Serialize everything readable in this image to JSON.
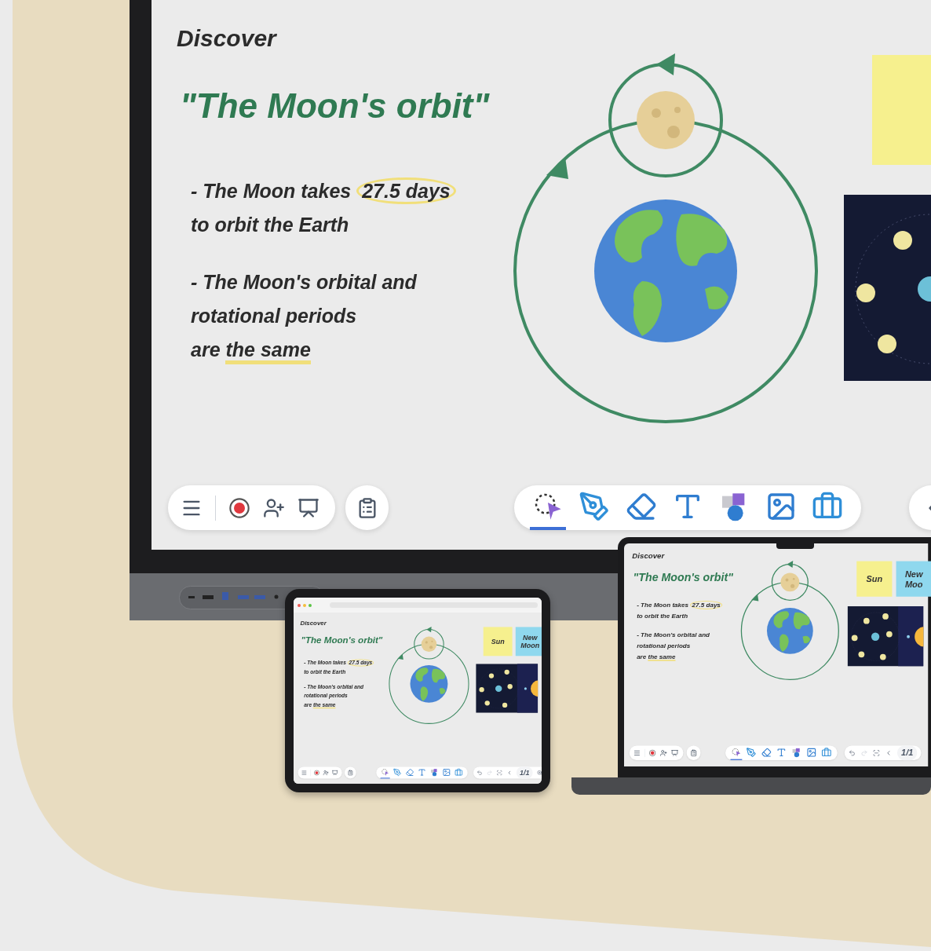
{
  "display": {
    "board": {
      "heading": "Discover",
      "title": "\"The Moon's orbit\"",
      "bullets": [
        {
          "lines": [
            [
              {
                "text": "- The Moon takes ",
                "kind": "plain"
              },
              {
                "text": "27.5 days",
                "kind": "circled"
              }
            ],
            [
              {
                "text": "to orbit the Earth",
                "kind": "plain"
              }
            ]
          ]
        },
        {
          "lines": [
            [
              {
                "text": "- The Moon's orbital and",
                "kind": "plain"
              }
            ],
            [
              {
                "text": "rotational periods",
                "kind": "plain"
              }
            ],
            [
              {
                "text": "are ",
                "kind": "plain"
              },
              {
                "text": "the same",
                "kind": "underlined"
              }
            ]
          ]
        }
      ],
      "notes": [
        {
          "color": "#f6f08e"
        }
      ],
      "tools": [
        {
          "selected": true
        },
        {
          "selected": false
        },
        {
          "selected": false
        },
        {
          "selected": false
        },
        {
          "selected": false
        },
        {
          "selected": false
        },
        {
          "selected": false
        }
      ],
      "right_toolbar": {
        "kind": "edge"
      }
    }
  },
  "tablet": {
    "board": {
      "heading": "Discover",
      "title": "\"The Moon's orbit\"",
      "bullets": [
        {
          "lines": [
            [
              {
                "text": "- The Moon takes ",
                "kind": "plain"
              },
              {
                "text": "27.5 days",
                "kind": "circled"
              }
            ],
            [
              {
                "text": "to orbit the Earth",
                "kind": "plain"
              }
            ]
          ]
        },
        {
          "lines": [
            [
              {
                "text": "- The Moon's orbital and",
                "kind": "plain"
              }
            ],
            [
              {
                "text": "rotational periods",
                "kind": "plain"
              }
            ],
            [
              {
                "text": "are ",
                "kind": "plain"
              },
              {
                "text": "the same",
                "kind": "underlined"
              }
            ]
          ]
        }
      ],
      "notes": [
        {
          "text": "Sun",
          "color": "#f6f08e"
        },
        {
          "text": "New Moon",
          "color": "#8fd8ee"
        }
      ],
      "tools": [
        {
          "selected": true
        },
        {
          "selected": false
        },
        {
          "selected": false
        },
        {
          "selected": false
        },
        {
          "selected": false
        },
        {
          "selected": false
        },
        {
          "selected": false
        }
      ],
      "right_toolbar": {
        "kind": "full",
        "page": "1/1"
      }
    }
  },
  "laptop": {
    "board": {
      "heading": "Discover",
      "title": "\"The Moon's orbit\"",
      "bullets": [
        {
          "lines": [
            [
              {
                "text": "- The Moon takes ",
                "kind": "plain"
              },
              {
                "text": "27.5 days",
                "kind": "circled"
              }
            ],
            [
              {
                "text": "to orbit the Earth",
                "kind": "plain"
              }
            ]
          ]
        },
        {
          "lines": [
            [
              {
                "text": "- The Moon's orbital and",
                "kind": "plain"
              }
            ],
            [
              {
                "text": "rotational periods",
                "kind": "plain"
              }
            ],
            [
              {
                "text": "are ",
                "kind": "plain"
              },
              {
                "text": "the same",
                "kind": "underlined"
              }
            ]
          ]
        }
      ],
      "notes": [
        {
          "text": "Sun",
          "color": "#f6f08e"
        },
        {
          "text": "New Moo",
          "color": "#8fd8ee"
        }
      ],
      "tools": [
        {
          "selected": true
        },
        {
          "selected": false
        },
        {
          "selected": false
        },
        {
          "selected": false
        },
        {
          "selected": false
        },
        {
          "selected": false
        },
        {
          "selected": false
        }
      ],
      "right_toolbar": {
        "kind": "cut",
        "page": "1/1"
      }
    }
  }
}
